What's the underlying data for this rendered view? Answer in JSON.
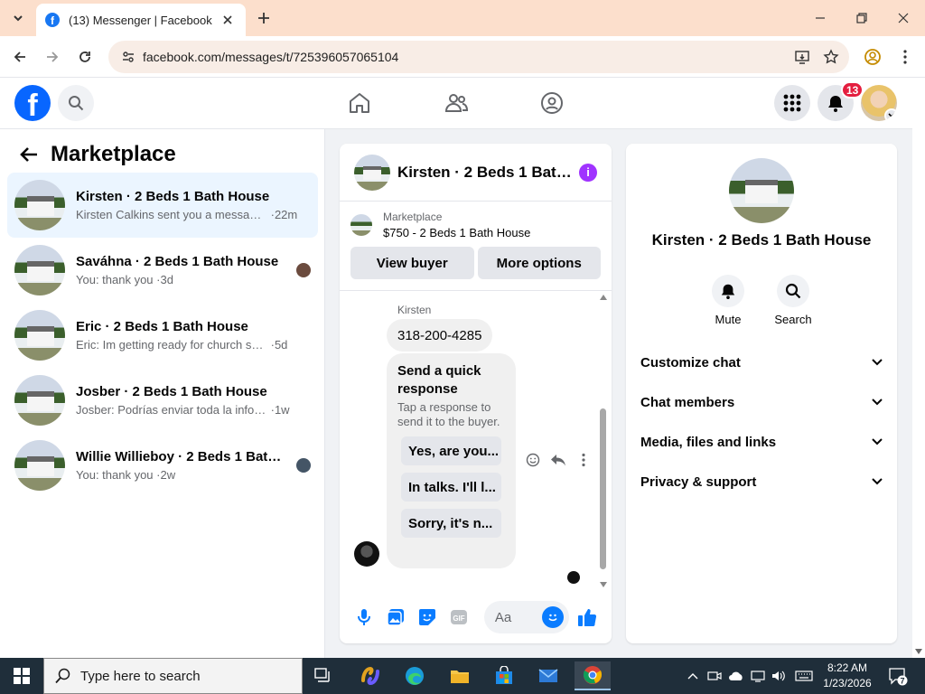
{
  "browser": {
    "tab_title": "(13) Messenger | Facebook",
    "url": "facebook.com/messages/t/725396057065104"
  },
  "header": {
    "notifications_count": "13"
  },
  "left": {
    "title": "Marketplace",
    "conversations": [
      {
        "name": "Kirsten · 2 Beds 1 Bath House",
        "preview": "Kirsten Calkins sent you a message ...",
        "time": "22m"
      },
      {
        "name": "Saváhna · 2 Beds 1 Bath House",
        "preview": "You: thank you",
        "time": "3d"
      },
      {
        "name": "Eric · 2 Beds 1 Bath House",
        "preview": "Eric: Im getting ready for church so yo...",
        "time": "5d"
      },
      {
        "name": "Josber · 2 Beds 1 Bath House",
        "preview": "Josber: Podrías enviar toda la informa...",
        "time": "1w"
      },
      {
        "name": "Willie Willieboy · 2 Beds 1 Bath ...",
        "preview": "You: thank you",
        "time": "2w"
      }
    ]
  },
  "chat": {
    "title": "Kirsten · 2 Beds 1 Bath House",
    "listing_label": "Marketplace",
    "listing_title": "$750 - 2 Beds 1 Bath House",
    "view_buyer": "View buyer",
    "more_options": "More options",
    "sender": "Kirsten",
    "phone_message": "318-200-4285",
    "card_title": "Send a quick response",
    "card_sub": "Tap a response to send it to the buyer.",
    "quick_replies": [
      "Yes, are you...",
      "In talks. I'll l...",
      "Sorry, it's n..."
    ],
    "composer_placeholder": "Aa"
  },
  "info": {
    "name": "Kirsten · 2 Beds 1 Bath House",
    "mute": "Mute",
    "search": "Search",
    "sections": [
      "Customize chat",
      "Chat members",
      "Media, files and links",
      "Privacy & support"
    ]
  },
  "taskbar": {
    "search_placeholder": "Type here to search",
    "time": "8:22 AM",
    "date": "1/23/2026",
    "notification_count": "7"
  }
}
